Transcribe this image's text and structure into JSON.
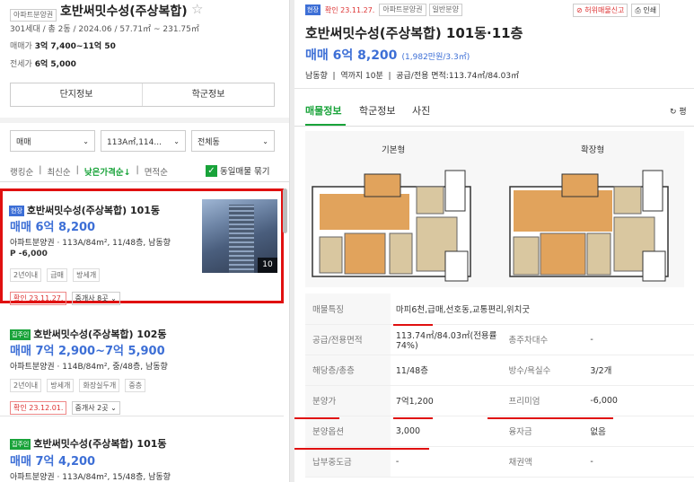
{
  "left": {
    "header": {
      "tag": "아파트분양권",
      "title": "호반써밋수성(주상복합)",
      "info": "301세대 / 총 2동 / 2024.06 / 57.71㎡ ~ 231.75㎡",
      "sale_label": "매매가",
      "sale_value": "3억 7,400~11억 50",
      "jeonse_label": "전세가",
      "jeonse_value": "6억 5,000"
    },
    "buttons": {
      "complex": "단지정보",
      "school": "학군정보"
    },
    "filters": {
      "type": "매매",
      "area": "113A㎡,114...",
      "dong": "전체동"
    },
    "sort": {
      "ranking": "랭킹순",
      "latest": "최신순",
      "low_price": "낮은가격순",
      "area": "면적순",
      "same_listing": "동일매물 묶기"
    },
    "listings": [
      {
        "badge": "현장",
        "title": "호반써밋수성(주상복합) 101동",
        "price": "매매 6억 8,200",
        "detail": "아파트분양권 · 113A/84m², 11/48층, 남동향",
        "premium": "P -6,000",
        "tags": [
          "2년이내",
          "급매",
          "방세개"
        ],
        "confirm": "확인 23.11.27.",
        "agent": "중개사 8곳",
        "photo_count": "10"
      },
      {
        "badge": "집주인",
        "title": "호반써밋수성(주상복합) 102동",
        "price": "매매 7억 2,900~7억 5,900",
        "detail": "아파트분양권 · 114B/84m², 중/48층, 남동향",
        "tags": [
          "2년이내",
          "방세개",
          "화장실두개",
          "중층"
        ],
        "confirm": "확인 23.12.01.",
        "agent": "중개사 2곳"
      },
      {
        "badge": "집주인",
        "title": "호반써밋수성(주상복합) 101동",
        "price": "매매 7억 4,200",
        "detail": "아파트분양권 · 113A/84m², 15/48층, 남동향"
      }
    ]
  },
  "right": {
    "badge": "현장",
    "confirm": "확인 23.11.27.",
    "tag1": "아파트분양권",
    "tag2": "일반분양",
    "report": "허위매물신고",
    "print": "인쇄",
    "title": "호반써밋수성(주상복합) 101동·11층",
    "price": "매매 6억 8,200",
    "price_sub": "(1,982만원/3.3㎡)",
    "summary": "남동향  |  역까지 10분  |  공급/전용 면적:113.74㎡/84.03㎡",
    "tabs": [
      "매물정보",
      "학군정보",
      "사진"
    ],
    "pyeong": "평",
    "plan_basic": "기본형",
    "plan_extended": "확장형",
    "specs": [
      {
        "k1": "매물특징",
        "v1": "마피6천,급매,선호동,교통편리,위치굿",
        "k2": "",
        "v2": ""
      },
      {
        "k1": "공급/전용면적",
        "v1": "113.74㎡/84.03㎡(전용률74%)",
        "k2": "총주차대수",
        "v2": "-"
      },
      {
        "k1": "해당층/총층",
        "v1": "11/48층",
        "k2": "방수/욕실수",
        "v2": "3/2개"
      },
      {
        "k1": "분양가",
        "v1": "7억1,200",
        "k2": "프리미엄",
        "v2": "-6,000"
      },
      {
        "k1": "분양옵션",
        "v1": "3,000",
        "k2": "융자금",
        "v2": "없음"
      },
      {
        "k1": "납부중도금",
        "v1": "-",
        "k2": "채권액",
        "v2": "-"
      }
    ]
  },
  "colors": {
    "accent": "#3d6fd6",
    "red": "#e01010",
    "green": "#19a33a"
  }
}
